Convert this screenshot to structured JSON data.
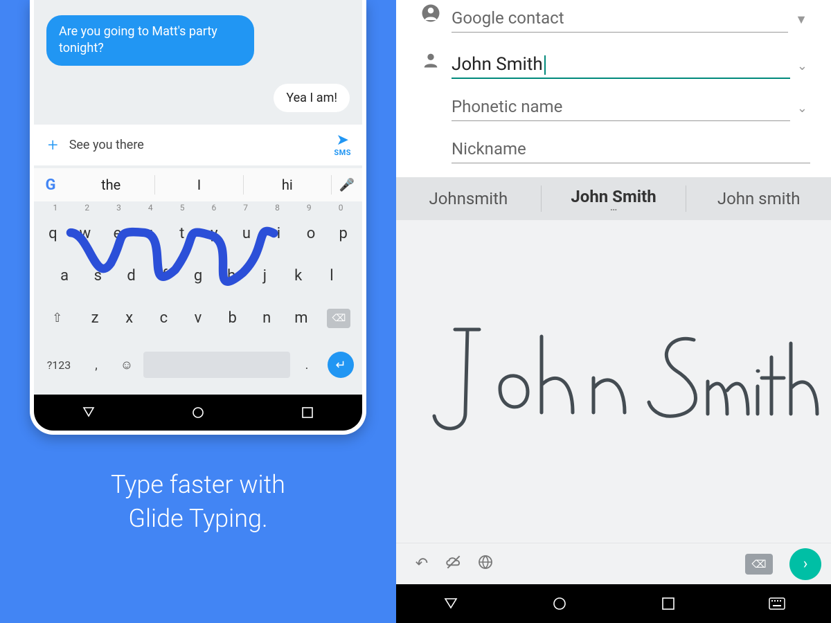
{
  "left": {
    "chat": {
      "incoming": "Are you going to Matt's party tonight?",
      "outgoing": "Yea I am!"
    },
    "compose": {
      "text": "See you there",
      "send_sublabel": "SMS"
    },
    "suggestions": [
      "the",
      "I",
      "hi"
    ],
    "keyboard": {
      "numbers": [
        "1",
        "2",
        "3",
        "4",
        "5",
        "6",
        "7",
        "8",
        "9",
        "0"
      ],
      "row1": [
        "q",
        "w",
        "e",
        "r",
        "t",
        "y",
        "u",
        "i",
        "o",
        "p"
      ],
      "row2": [
        "a",
        "s",
        "d",
        "f",
        "g",
        "h",
        "j",
        "k",
        "l"
      ],
      "row3": [
        "z",
        "x",
        "c",
        "v",
        "b",
        "n",
        "m"
      ],
      "sym_label": "?123"
    },
    "promo_line1": "Type faster with",
    "promo_line2": "Glide Typing."
  },
  "right": {
    "contact_type": "Google contact",
    "name_value": "John Smith",
    "phonetic_label": "Phonetic name",
    "nickname_label": "Nickname",
    "predictions": [
      "Johnsmith",
      "John Smith",
      "John smith"
    ],
    "handwriting_text": "John Smith"
  }
}
